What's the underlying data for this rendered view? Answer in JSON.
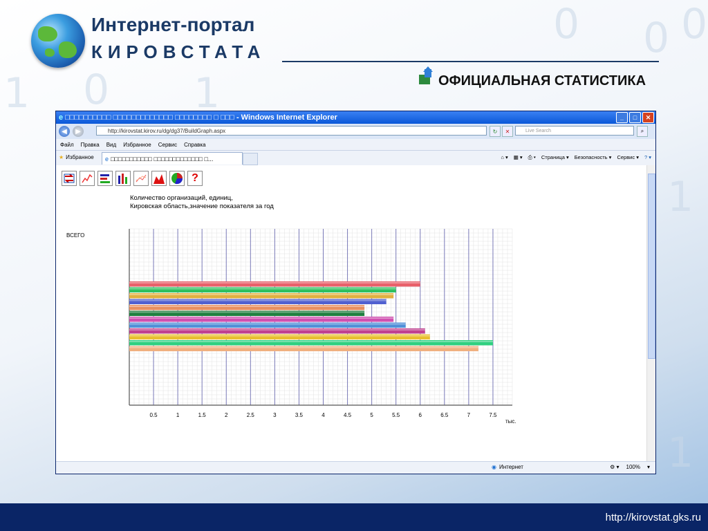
{
  "header": {
    "title": "Интернет-портал",
    "subtitle": "КИРОВСТАТА",
    "tagline": "ОФИЦИАЛЬНАЯ СТАТИСТИКА"
  },
  "footer": {
    "url": "http://kirovstat.gks.ru"
  },
  "browser": {
    "window_title": "□□□□□□□□□□ □□□□□□□□□□□□□ □□□□□□□□ □ □□□ - Windows Internet Explorer",
    "address": "http://kirovstat.kirov.ru/dg/dg37/BuildGraph.aspx",
    "search_placeholder": "Live Search",
    "menu": [
      "Файл",
      "Правка",
      "Вид",
      "Избранное",
      "Сервис",
      "Справка"
    ],
    "favorites_label": "Избранное",
    "tab_label": "□□□□□□□□□□□ □□□□□□□□□□□□□ □...",
    "commands": [
      "Страница ▾",
      "Безопасность ▾",
      "Сервис ▾"
    ],
    "status_zone": "Интернет",
    "zoom": "100%"
  },
  "chart_data": {
    "type": "bar",
    "orientation": "horizontal",
    "title_line1": "Количество организаций, единиц,",
    "title_line2": "Кировская область,значение показателя за год",
    "ylabel": "ВСЕГО",
    "xlabel": "тыс.",
    "xlim": [
      0,
      7.9
    ],
    "xticks": [
      "0.5",
      "1",
      "1.5",
      "2",
      "2.5",
      "3",
      "3.5",
      "4",
      "4.5",
      "5",
      "5.5",
      "6",
      "6.5",
      "7",
      "7.5"
    ],
    "values": [
      6.0,
      5.5,
      5.45,
      5.3,
      4.85,
      4.85,
      5.45,
      5.7,
      6.1,
      6.2,
      7.5,
      7.2
    ],
    "colors": [
      "#e8606a",
      "#2ec060",
      "#e0b040",
      "#5060d0",
      "#e89060",
      "#208040",
      "#d050b0",
      "#5090d8",
      "#c04090",
      "#e8c030",
      "#30d080",
      "#f0b080"
    ]
  }
}
